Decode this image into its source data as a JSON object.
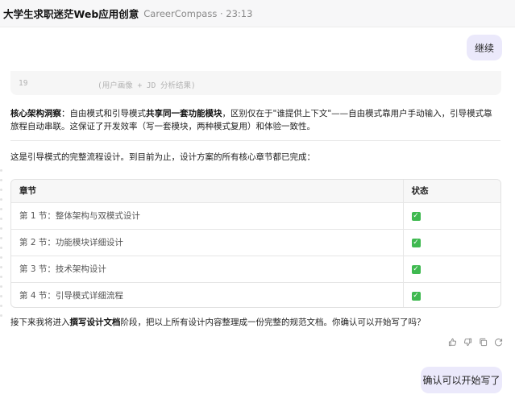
{
  "header": {
    "title": "大学生求职迷茫Web应用创意",
    "meta": "CareerCompass · 23:13"
  },
  "messages": {
    "user1": "继续",
    "user2": "确认可以开始写了"
  },
  "code_snippet": {
    "line_number": "19",
    "text": "(用户画像 + JD 分析结果)"
  },
  "insight": {
    "label": "核心架构洞察",
    "text_a": "：自由模式和引导模式",
    "bold": "共享同一套功能模块",
    "text_b": "，区别仅在于\"谁提供上下文\"——自由模式靠用户手动输入，引导模式靠旅程自动串联。这保证了开发效率（写一套模块，两种模式复用）和体验一致性。"
  },
  "summary": "这是引导模式的完整流程设计。到目前为止，设计方案的所有核心章节都已完成：",
  "table": {
    "headers": {
      "chapter": "章节",
      "status": "状态"
    },
    "rows": [
      {
        "chapter": "第 1 节：整体架构与双模式设计",
        "status": "✓"
      },
      {
        "chapter": "第 2 节：功能模块详细设计",
        "status": "✓"
      },
      {
        "chapter": "第 3 节：技术架构设计",
        "status": "✓"
      },
      {
        "chapter": "第 4 节：引导模式详细流程",
        "status": "✓"
      }
    ]
  },
  "outro": {
    "before": "接下来我将进入",
    "bold": "撰写设计文档",
    "after": "阶段，把以上所有设计内容整理成一份完整的规范文档。你确认可以开始写了吗？"
  },
  "icons": [
    "thumbs-up-icon",
    "thumbs-down-icon",
    "copy-icon",
    "refresh-icon"
  ],
  "colors": {
    "user_bubble": "#ebe9fb",
    "check": "#3fb950",
    "header_bg": "#f7f7f8"
  }
}
